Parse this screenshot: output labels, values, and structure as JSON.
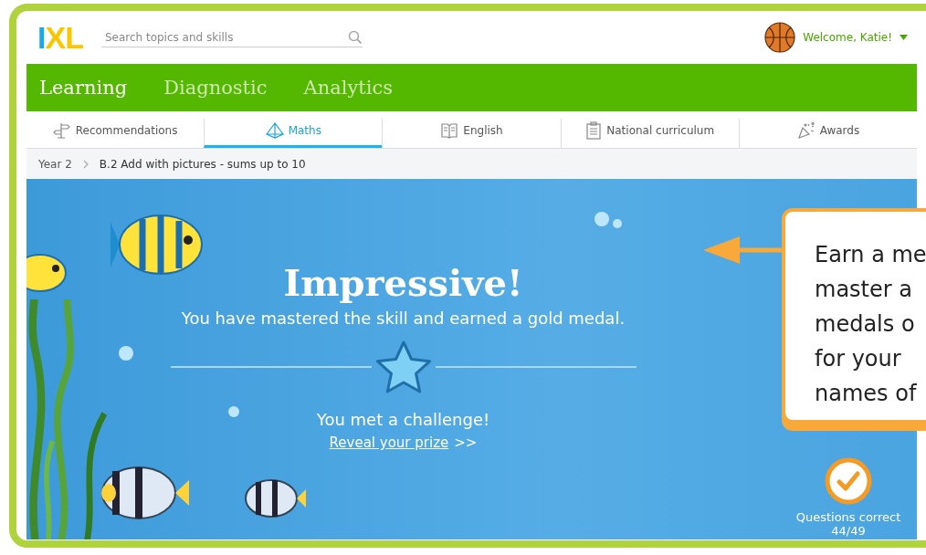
{
  "header": {
    "logo": [
      {
        "text": "I",
        "color": "#19a9e6"
      },
      {
        "text": "XL",
        "color": "#fbc500"
      }
    ],
    "search": {
      "placeholder": "Search topics and skills"
    },
    "user": {
      "greeting": "Welcome, Katie!"
    }
  },
  "main_nav": [
    {
      "label": "Learning",
      "selected": true
    },
    {
      "label": "Diagnostic",
      "selected": false
    },
    {
      "label": "Analytics",
      "selected": false
    }
  ],
  "sub_nav": [
    {
      "label": "Recommendations",
      "kind": "signpost",
      "selected": false
    },
    {
      "label": "Maths",
      "kind": "pyramid",
      "selected": true
    },
    {
      "label": "English",
      "kind": "book",
      "selected": false
    },
    {
      "label": "National curriculum",
      "kind": "clipboard",
      "selected": false
    },
    {
      "label": "Awards",
      "kind": "party",
      "selected": false
    }
  ],
  "breadcrumb": [
    "Year 2",
    "B.2 Add with pictures - sums up to 10"
  ],
  "result": {
    "title": "Impressive!",
    "message": "You have mastered the skill and earned a gold medal.",
    "challenge": "You met a challenge!",
    "link": "Reveal your prize",
    "link_suffix": ">>"
  },
  "stats": {
    "label": "Questions correct",
    "value": "44/49"
  },
  "callout": {
    "lines": [
      "Earn a me",
      "master a",
      "medals o",
      "for your",
      "names of"
    ]
  }
}
